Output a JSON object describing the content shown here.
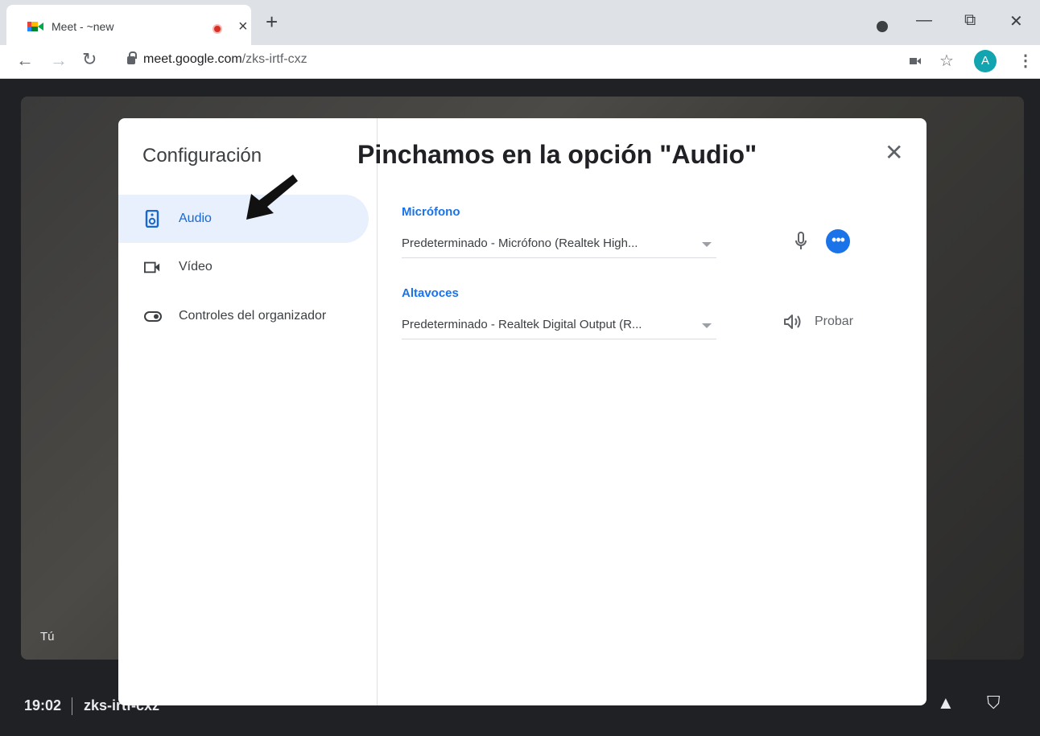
{
  "browser": {
    "tab_title": "Meet - ~new",
    "tab_close": "×",
    "new_tab": "+",
    "url_host": "meet.google.com",
    "url_path": "/zks-irtf-cxz",
    "avatar_letter": "A",
    "minimize": "—",
    "restore": "⧉",
    "close": "✕"
  },
  "meet": {
    "self_label": "Tú",
    "time": "19:02",
    "meeting_code": "zks-irtf-cxz"
  },
  "dialog": {
    "title": "Configuración",
    "annotation": "Pinchamos en la opción \"Audio\"",
    "close": "✕",
    "nav": [
      {
        "label": "Audio",
        "icon": "speaker-icon",
        "active": true
      },
      {
        "label": "Vídeo",
        "icon": "videocam-icon"
      },
      {
        "label": "Controles del organizador",
        "icon": "toggle-icon"
      }
    ],
    "microphone": {
      "label": "Micrófono",
      "value": "Predeterminado - Micrófono (Realtek High..."
    },
    "speakers": {
      "label": "Altavoces",
      "value": "Predeterminado - Realtek Digital Output (R...",
      "test_label": "Probar"
    }
  },
  "colors": {
    "accent": "#1a73e8",
    "active_bg": "#e8f0fe",
    "record": "#d93025"
  }
}
